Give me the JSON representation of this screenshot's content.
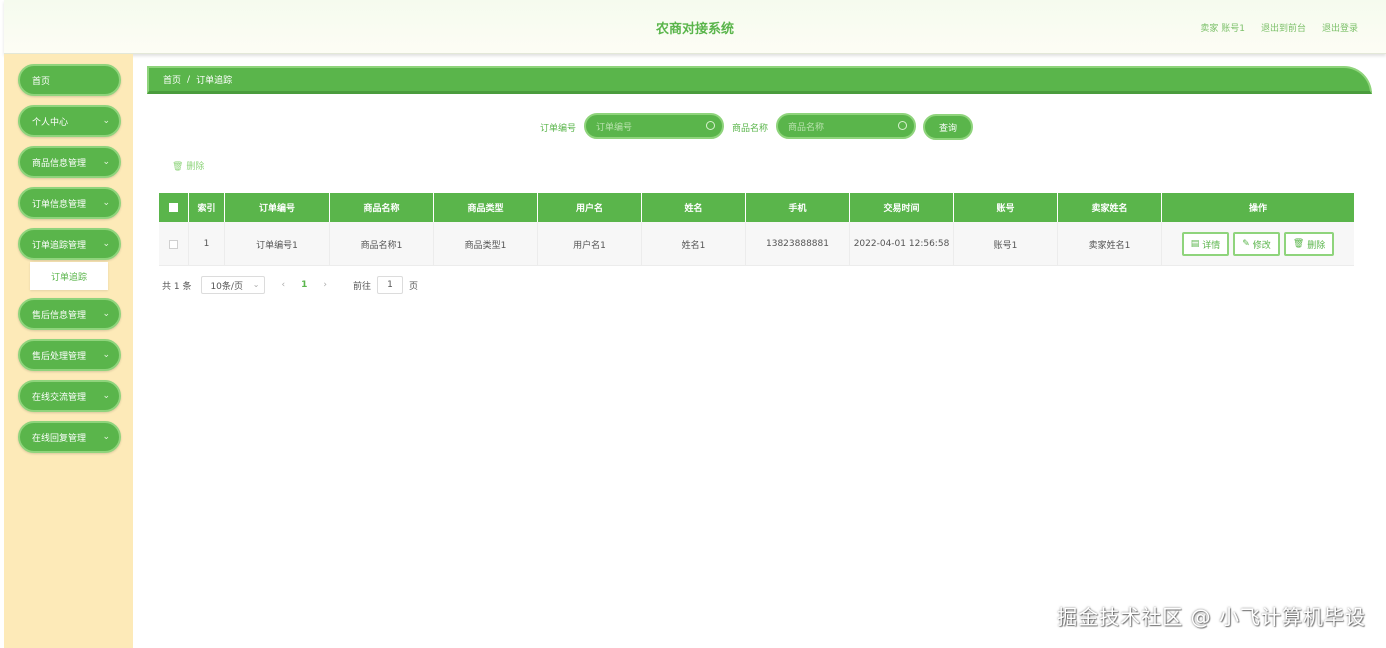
{
  "header": {
    "title": "农商对接系统",
    "user_label": "卖家 账号1",
    "to_front": "退出到前台",
    "logout": "退出登录"
  },
  "sidebar": {
    "items": [
      {
        "label": "首页",
        "has_chevron": false
      },
      {
        "label": "个人中心",
        "has_chevron": true
      },
      {
        "label": "商品信息管理",
        "has_chevron": true
      },
      {
        "label": "订单信息管理",
        "has_chevron": true
      },
      {
        "label": "订单追踪管理",
        "has_chevron": true,
        "expanded": true
      },
      {
        "label": "售后信息管理",
        "has_chevron": true
      },
      {
        "label": "售后处理管理",
        "has_chevron": true
      },
      {
        "label": "在线交流管理",
        "has_chevron": true
      },
      {
        "label": "在线回复管理",
        "has_chevron": true
      }
    ],
    "sub_item": "订单追踪"
  },
  "breadcrumb": {
    "home": "首页",
    "separator": "/",
    "current": "订单追踪"
  },
  "search": {
    "order_no_label": "订单编号",
    "order_no_placeholder": "订单编号",
    "product_label": "商品名称",
    "product_placeholder": "商品名称",
    "query_button": "查询"
  },
  "toolbar": {
    "delete_label": "删除"
  },
  "table": {
    "headers": [
      "",
      "索引",
      "订单编号",
      "商品名称",
      "商品类型",
      "用户名",
      "姓名",
      "手机",
      "交易时间",
      "账号",
      "卖家姓名",
      "操作"
    ],
    "rows": [
      {
        "index": "1",
        "order_no": "订单编号1",
        "product_name": "商品名称1",
        "product_type": "商品类型1",
        "username": "用户名1",
        "name": "姓名1",
        "phone": "13823888881",
        "trade_time": "2022-04-01 12:56:58",
        "account": "账号1",
        "seller_name": "卖家姓名1",
        "actions": {
          "detail": "详情",
          "edit": "修改",
          "delete": "删除"
        }
      }
    ]
  },
  "pagination": {
    "total": "共 1 条",
    "page_size": "10条/页",
    "current_page": "1",
    "goto_label": "前往",
    "goto_value": "1",
    "goto_suffix": "页"
  },
  "watermark": "掘金技术社区 @ 小飞计算机毕设",
  "colors": {
    "accent": "#5ab54b",
    "accent_light": "#8fd47c",
    "sidebar_bg": "#fdeab8"
  }
}
